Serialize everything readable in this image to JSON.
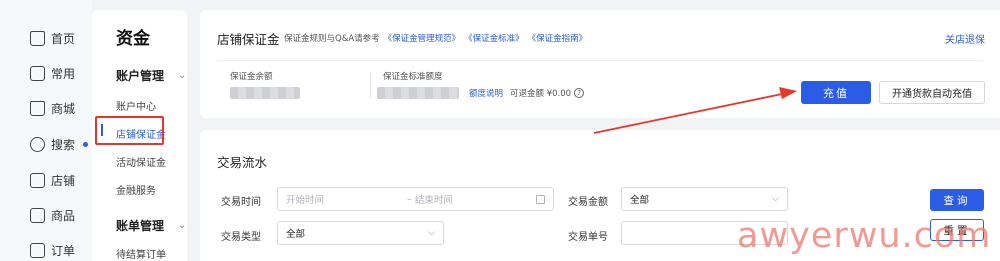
{
  "nav": {
    "items": [
      {
        "label": "首页",
        "icon": "home-icon"
      },
      {
        "label": "常用",
        "icon": "folder-icon"
      },
      {
        "label": "商城",
        "icon": "store-icon"
      },
      {
        "label": "搜索",
        "icon": "search-icon"
      },
      {
        "label": "店铺",
        "icon": "shop-icon"
      },
      {
        "label": "商品",
        "icon": "product-icon"
      },
      {
        "label": "订单",
        "icon": "order-icon"
      }
    ]
  },
  "submenu": {
    "title": "资金",
    "group1": "账户管理",
    "items1": [
      "账户中心",
      "店铺保证金",
      "活动保证金",
      "金融服务"
    ],
    "group2": "账单管理",
    "items2": [
      "待结算订单"
    ]
  },
  "deposit": {
    "title": "店铺保证金",
    "ref_prefix": "保证金规则与Q&A请参考",
    "links": [
      "《保证金管理规范》",
      "《保证金标准》",
      "《保证金指南》"
    ],
    "close_shop": "关店退保",
    "balance_label": "保证金余额",
    "standard_label": "保证金标准额度",
    "quota_link": "额度说明",
    "refundable": "可退金额 ¥0.00",
    "help_icon": "question-circle-icon",
    "recharge_btn": "充值",
    "auto_recharge_btn": "开通货款自动充值"
  },
  "transactions": {
    "title": "交易流水",
    "time_label": "交易时间",
    "start_placeholder": "开始时间",
    "end_placeholder": "结束时间",
    "amount_label": "交易金额",
    "amount_value": "全部",
    "type_label": "交易类型",
    "type_value": "全部",
    "number_label": "交易单号",
    "query_btn": "查询",
    "reset_btn": "重置"
  },
  "watermark": "awyerwu.com",
  "colors": {
    "accent": "#2b5ce6",
    "highlight_red": "#e5372c"
  }
}
